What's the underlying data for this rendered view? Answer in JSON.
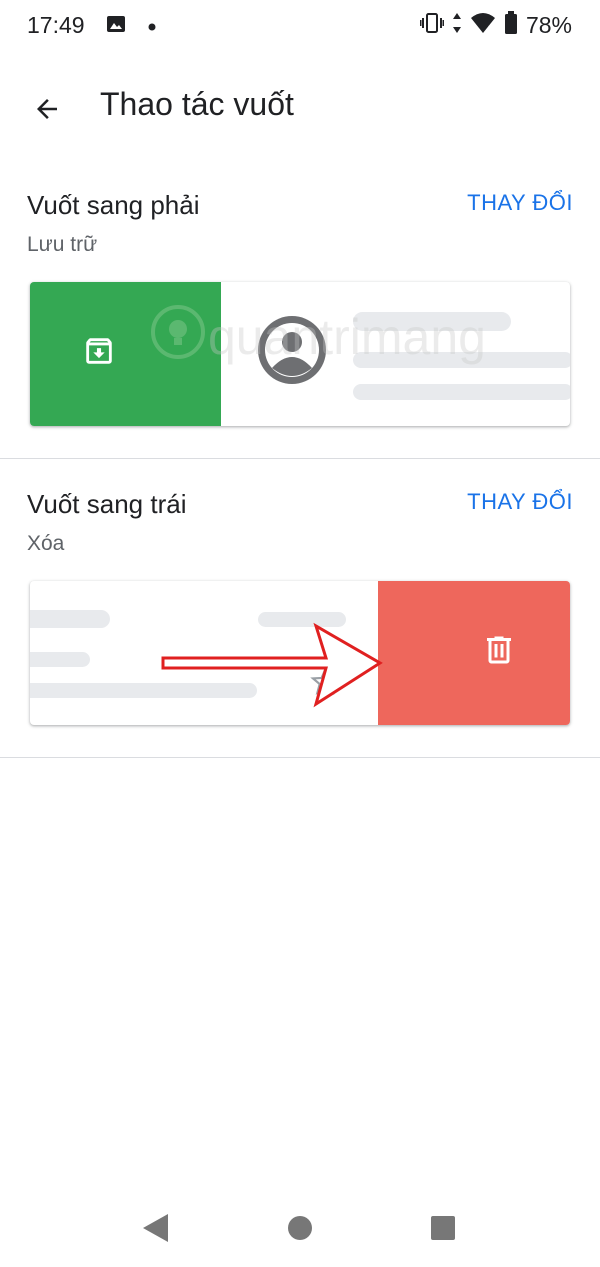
{
  "status_bar": {
    "time": "17:49",
    "battery": "78%",
    "icons": [
      "image-icon",
      "notification-dot-icon",
      "vibrate-icon",
      "data-arrows-icon",
      "wifi-icon",
      "battery-icon"
    ]
  },
  "app_bar": {
    "title": "Thao tác vuốt",
    "back_icon": "arrow-back-icon"
  },
  "swipe_right": {
    "title": "Vuốt sang phải",
    "action": "Lưu trữ",
    "change_label": "THAY ĐỔI",
    "action_color": "#34a853",
    "action_icon": "archive-icon"
  },
  "swipe_left": {
    "title": "Vuốt sang trái",
    "action": "Xóa",
    "change_label": "THAY ĐỔI",
    "action_color": "#ee675c",
    "action_icon": "delete-icon"
  },
  "watermark": {
    "text": "quantrimang"
  },
  "colors": {
    "accent": "#1a73e8",
    "skeleton": "#e8eaed",
    "annotation_arrow": "#e02020"
  },
  "nav_bar": {
    "icons": [
      "nav-back-icon",
      "nav-home-icon",
      "nav-recents-icon"
    ]
  }
}
